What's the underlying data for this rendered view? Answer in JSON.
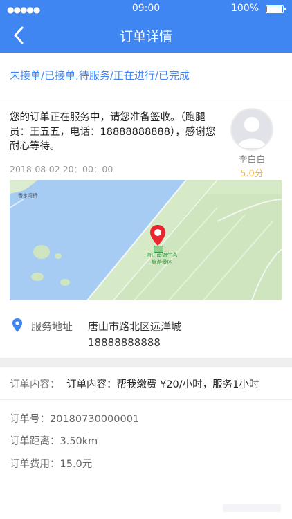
{
  "status_bar": {
    "signal": "●●●●●",
    "time": "09:00",
    "battery": "100%"
  },
  "header": {
    "title": "订单详情",
    "back_icon": "chevron-left-icon"
  },
  "order_flow": "未接单/已接单,待服务/正在进行/已完成",
  "message": {
    "text": "您的订单正在服务中，请您准备签收。（跑腿员：王五五，电话：18888888888），感谢您耐心等待。",
    "time": "2018-08-02 20：00：00"
  },
  "runner": {
    "name": "李白白",
    "rating": "5.0分"
  },
  "map": {
    "place_label_1": "香水湾桥",
    "place_label_2_line1": "唐山南湖生态",
    "place_label_2_line2": "旅游景区"
  },
  "address": {
    "label": "服务地址",
    "value": "唐山市路北区远洋城",
    "phone": "18888888888"
  },
  "content": {
    "label": "订单内容：",
    "value": "订单内容：帮我缴费 ¥20/小时，服务1小时"
  },
  "details": {
    "order_no_label": "订单号：",
    "order_no": "20180730000001",
    "distance_label": "订单距离：",
    "distance": "3.50km",
    "fee_label": "订单费用：",
    "fee": "15.0元"
  },
  "colors": {
    "primary": "#3f86f3",
    "rating": "#f1b33b",
    "marker": "#e8262e"
  }
}
